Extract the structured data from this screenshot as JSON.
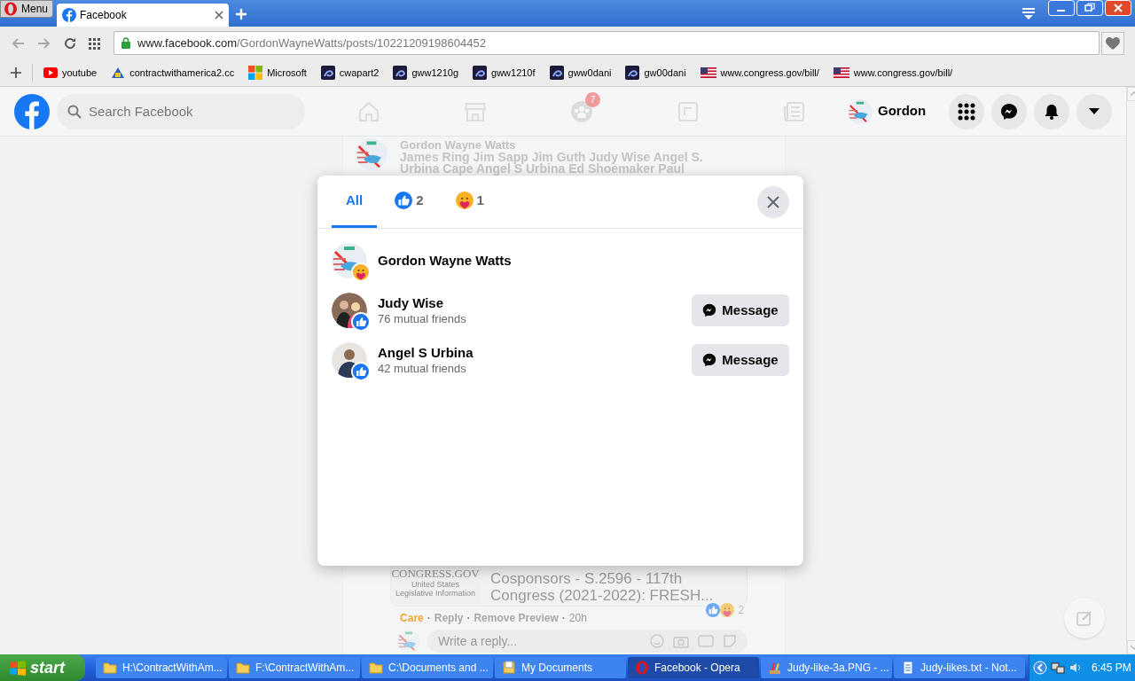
{
  "browser": {
    "menu_label": "Menu",
    "tabs": [
      {
        "title": "Facebook",
        "selected": true
      }
    ],
    "address": {
      "domain": "www.facebook.com",
      "path": "/GordonWayneWatts/posts/10221209198604452"
    },
    "bookmarks": [
      {
        "label": "youtube",
        "kind": "youtube"
      },
      {
        "label": "contractwithamerica2.cc",
        "kind": "site"
      },
      {
        "label": "Microsoft",
        "kind": "windows"
      },
      {
        "label": "cwapart2",
        "kind": "swirl"
      },
      {
        "label": "gww1210g",
        "kind": "swirl"
      },
      {
        "label": "gww1210f",
        "kind": "swirl"
      },
      {
        "label": "gww0dani",
        "kind": "swirl"
      },
      {
        "label": "gw00dani",
        "kind": "swirl"
      },
      {
        "label": "www.congress.gov/bill/",
        "kind": "flag"
      },
      {
        "label": "www.congress.gov/bill/",
        "kind": "flag"
      }
    ]
  },
  "header": {
    "search": {
      "placeholder": "Search Facebook"
    },
    "nav": [
      {
        "kind": "home"
      },
      {
        "kind": "store"
      },
      {
        "kind": "groups",
        "badge": "7"
      },
      {
        "kind": "gaming"
      },
      {
        "kind": "news"
      }
    ],
    "profile_name": "Gordon"
  },
  "post": {
    "author": "Gordon Wayne Watts",
    "text_lines": [
      "James Ring Jim Sapp Jim Guth Judy Wise Angel S.",
      "Urbina Cape Angel S Urbina Ed Shoemaker Paul"
    ],
    "preview": {
      "logo_text": "CONGRESS.GOV",
      "logo_subtitle": "United States Legislative Information",
      "lines": [
        "Cosponsors - S.2596 - 117th",
        "Congress (2021-2022): FRESH..."
      ]
    },
    "actions": [
      {
        "label": "Care",
        "kind": "reaction"
      },
      {
        "label": "Reply",
        "kind": "link"
      },
      {
        "label": "Remove Preview",
        "kind": "link"
      },
      {
        "label": "20h",
        "kind": "time"
      }
    ],
    "separator": "·",
    "reaction_count": "2",
    "reply": {
      "placeholder": "Write a reply..."
    }
  },
  "reactions_dialog": {
    "tabs": [
      {
        "label": "All",
        "kind": "all",
        "selected": true
      },
      {
        "kind": "like",
        "count": "2",
        "selected": false
      },
      {
        "kind": "care",
        "count": "1",
        "selected": false
      }
    ],
    "people": [
      {
        "name": "Gordon Wayne Watts",
        "kind": "care"
      },
      {
        "name": "Judy Wise",
        "mutual": "76 mutual friends",
        "kind": "like",
        "button": "Message"
      },
      {
        "name": "Angel S Urbina",
        "mutual": "42 mutual friends",
        "kind": "like",
        "button": "Message"
      }
    ]
  },
  "taskbar": {
    "start_label": "start",
    "items": [
      {
        "label": "H:\\ContractWithAm...",
        "kind": "folder",
        "selected": false
      },
      {
        "label": "F:\\ContractWithAm...",
        "kind": "folder",
        "selected": false
      },
      {
        "label": "C:\\Documents and ...",
        "kind": "folder",
        "selected": false
      },
      {
        "label": "My Documents",
        "kind": "documents",
        "selected": false
      },
      {
        "label": "Facebook - Opera",
        "kind": "opera",
        "selected": true
      },
      {
        "label": "Judy-like-3a.PNG - ...",
        "kind": "paint",
        "selected": false
      },
      {
        "label": "Judy-likes.txt - Not...",
        "kind": "notepad",
        "selected": false
      }
    ],
    "clock": "6:45 PM"
  }
}
